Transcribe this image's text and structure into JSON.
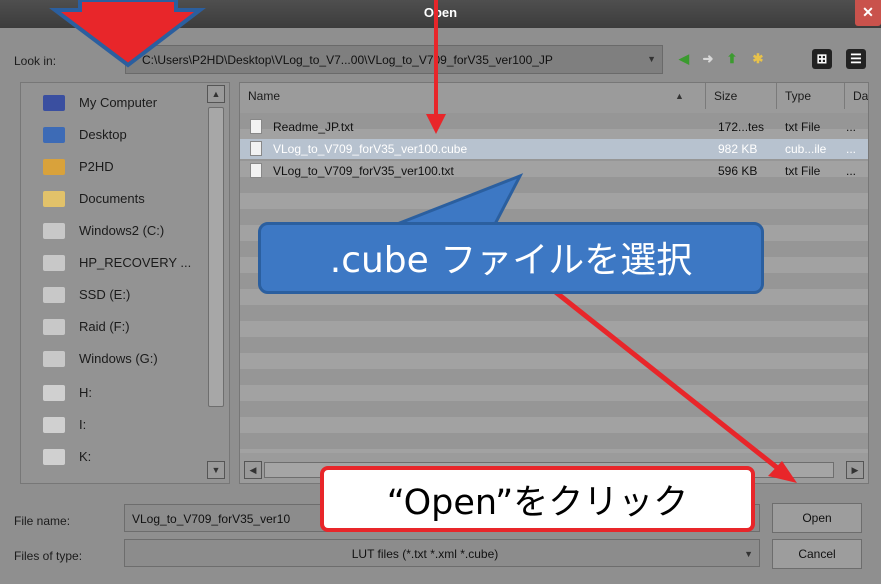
{
  "dialog": {
    "title": "Open",
    "close_glyph": "✕"
  },
  "lookin": {
    "label": "Look in:",
    "path": "C:\\Users\\P2HD\\Desktop\\VLog_to_V7...00\\VLog_to_V709_forV35_ver100_JP"
  },
  "toolbar": {
    "back": "◀",
    "forward": "➜",
    "up": "⬆",
    "new_folder": "✱",
    "view": "⊞",
    "details": "☰"
  },
  "places": [
    {
      "label": "My Computer",
      "icon": "my-computer-icon",
      "color": "#3a4fa0"
    },
    {
      "label": "Desktop",
      "icon": "desktop-icon",
      "color": "#3d6bb6"
    },
    {
      "label": "P2HD",
      "icon": "user-folder-icon",
      "color": "#d9a23b"
    },
    {
      "label": "Documents",
      "icon": "documents-icon",
      "color": "#e2c26a"
    },
    {
      "label": "Windows2 (C:)",
      "icon": "drive-icon",
      "color": "#c8c8c8"
    },
    {
      "label": "HP_RECOVERY ...",
      "icon": "drive-icon",
      "color": "#c8c8c8"
    },
    {
      "label": "SSD (E:)",
      "icon": "drive-icon",
      "color": "#c8c8c8"
    },
    {
      "label": "Raid (F:)",
      "icon": "drive-icon",
      "color": "#c8c8c8"
    },
    {
      "label": "Windows (G:)",
      "icon": "drive-icon",
      "color": "#c8c8c8"
    },
    {
      "label": "H:",
      "icon": "dvd-drive-icon",
      "color": "#d0d0d0"
    },
    {
      "label": "I:",
      "icon": "dvd-drive-icon",
      "color": "#d0d0d0"
    },
    {
      "label": "K:",
      "icon": "dvd-drive-icon",
      "color": "#d0d0d0"
    }
  ],
  "columns": {
    "name": "Name",
    "size": "Size",
    "type": "Type",
    "date": "Da"
  },
  "files": [
    {
      "name": "Readme_JP.txt",
      "size": "172...tes",
      "type": "txt File",
      "date": "..."
    },
    {
      "name": "VLog_to_V709_forV35_ver100.cube",
      "size": "982 KB",
      "type": "cub...ile",
      "date": "..."
    },
    {
      "name": "VLog_to_V709_forV35_ver100.txt",
      "size": "596 KB",
      "type": "txt File",
      "date": "..."
    }
  ],
  "filename": {
    "label": "File name:",
    "value": "VLog_to_V709_forV35_ver10"
  },
  "filetype": {
    "label": "Files of type:",
    "value": "LUT files (*.txt *.xml *.cube)"
  },
  "buttons": {
    "open": "Open",
    "cancel": "Cancel"
  },
  "annotations": {
    "callout_select": ".cube ファイルを選択",
    "callout_click": "“Open”をクリック",
    "callout_color": "#3d78c4",
    "arrow_color": "#e8262a"
  }
}
